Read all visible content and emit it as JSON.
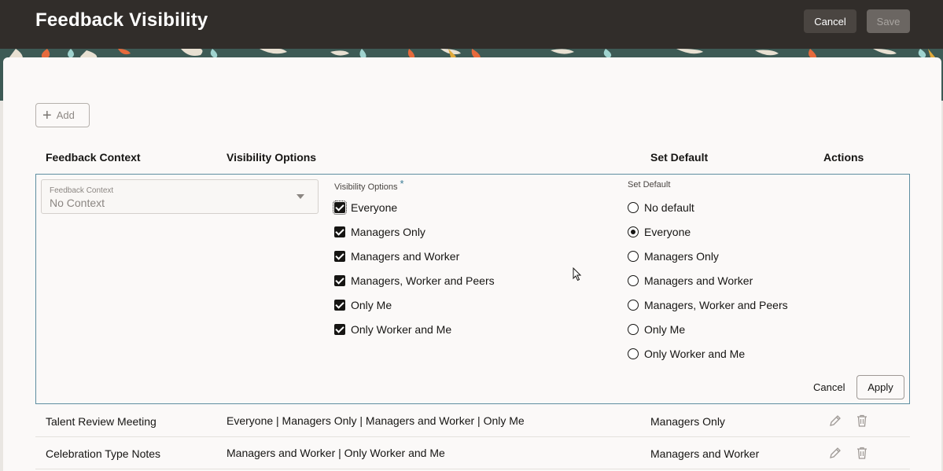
{
  "header": {
    "title": "Feedback Visibility",
    "cancel_label": "Cancel",
    "save_label": "Save"
  },
  "toolbar": {
    "add_label": "Add"
  },
  "columns": {
    "context": "Feedback Context",
    "visibility": "Visibility Options",
    "default": "Set Default",
    "actions": "Actions"
  },
  "edit_row": {
    "context_label": "Feedback Context",
    "context_value": "No Context",
    "visibility_label": "Visibility Options",
    "required_mark": "*",
    "visibility_options": [
      {
        "label": "Everyone",
        "checked": true
      },
      {
        "label": "Managers Only",
        "checked": true
      },
      {
        "label": "Managers and Worker",
        "checked": true
      },
      {
        "label": "Managers, Worker and Peers",
        "checked": true
      },
      {
        "label": "Only Me",
        "checked": true
      },
      {
        "label": "Only Worker and Me",
        "checked": true
      }
    ],
    "default_label": "Set Default",
    "default_options": [
      {
        "label": "No default",
        "selected": false
      },
      {
        "label": "Everyone",
        "selected": true
      },
      {
        "label": "Managers Only",
        "selected": false
      },
      {
        "label": "Managers and Worker",
        "selected": false
      },
      {
        "label": "Managers, Worker and Peers",
        "selected": false
      },
      {
        "label": "Only Me",
        "selected": false
      },
      {
        "label": "Only Worker and Me",
        "selected": false
      }
    ],
    "cancel_label": "Cancel",
    "apply_label": "Apply"
  },
  "rows": [
    {
      "context": "Talent Review Meeting",
      "visibility": "Everyone | Managers Only | Managers and Worker | Only Me",
      "default": "Managers Only"
    },
    {
      "context": "Celebration Type Notes",
      "visibility": "Managers and Worker | Only Worker and Me",
      "default": "Managers and Worker"
    }
  ],
  "icons": {
    "edit": "pencil-icon",
    "delete": "trash-icon",
    "add": "plus-icon",
    "dropdown": "chevron-down-icon"
  }
}
